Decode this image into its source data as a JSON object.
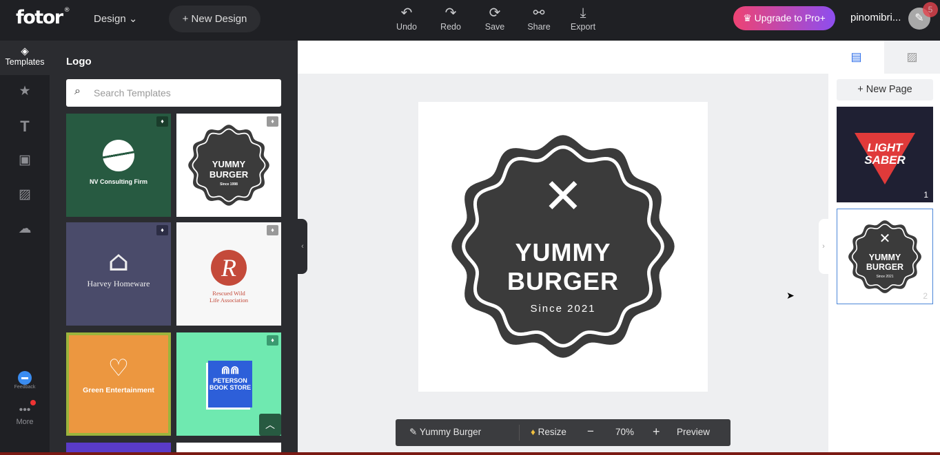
{
  "header": {
    "logo": "fotor",
    "logo_mark": "®",
    "design_menu": "Design",
    "new_design": "+ New Design",
    "tools": [
      {
        "label": "Undo",
        "icon": "undo-icon"
      },
      {
        "label": "Redo",
        "icon": "redo-icon"
      },
      {
        "label": "Save",
        "icon": "save-icon"
      },
      {
        "label": "Share",
        "icon": "share-icon"
      },
      {
        "label": "Export",
        "icon": "export-icon"
      }
    ],
    "upgrade": "Upgrade to Pro+",
    "username": "pinomibri...",
    "notification_count": "5"
  },
  "rail": {
    "templates": "Templates",
    "feedback": "Feedback",
    "more": "More"
  },
  "panel": {
    "title": "Logo",
    "search_placeholder": "Search Templates",
    "templates": [
      {
        "text": "NV Consulting Firm",
        "bg": "#275a41"
      },
      {
        "text": "YUMMY",
        "text2": "BURGER",
        "text3": "Since 1998",
        "bg": "#ffffff"
      },
      {
        "text": "Harvey Homeware",
        "bg": "#4a4b6a"
      },
      {
        "text": "Rescued Wild",
        "text2": "Life Association",
        "bg": "#f7f7f7"
      },
      {
        "text": "Green Entertainment",
        "bg": "#ec9740"
      },
      {
        "text": "PETERSON",
        "text2": "BOOK STORE",
        "bg": "#6fe9b0"
      }
    ]
  },
  "canvas": {
    "line1": "YUMMY",
    "line2": "BURGER",
    "line3": "Since 2021",
    "badge_color": "#3b3b3b"
  },
  "bottom_bar": {
    "name": "Yummy Burger",
    "resize": "Resize",
    "zoom": "70%",
    "preview": "Preview"
  },
  "right": {
    "new_page": "+ New Page",
    "pages": [
      {
        "num": "1",
        "line1": "LIGHT",
        "line2": "SABER"
      },
      {
        "num": "2",
        "line1": "YUMMY",
        "line2": "BURGER",
        "line3": "Since 2021"
      }
    ]
  }
}
